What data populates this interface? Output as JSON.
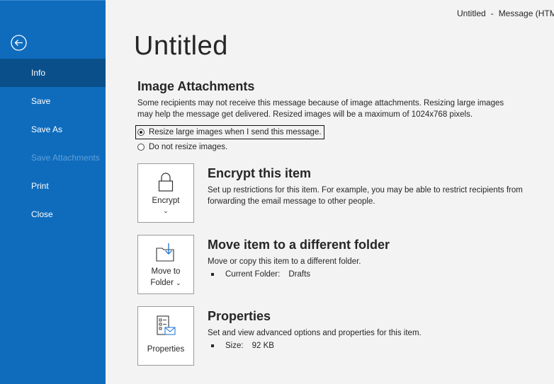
{
  "window": {
    "title": "Untitled",
    "separator": "-",
    "app_title": "Message (HTM"
  },
  "nav": {
    "items": [
      {
        "label": "Info",
        "active": true
      },
      {
        "label": "Save"
      },
      {
        "label": "Save As"
      },
      {
        "label": "Save Attachments",
        "disabled": true
      },
      {
        "label": "Print"
      },
      {
        "label": "Close"
      }
    ]
  },
  "page": {
    "title": "Untitled"
  },
  "image_attachments": {
    "heading": "Image Attachments",
    "description": "Some recipients may not receive this message because of image attachments. Resizing large images may help the message get delivered. Resized images will be a maximum of 1024x768 pixels.",
    "options": [
      {
        "label": "Resize large images when I send this message.",
        "selected": true
      },
      {
        "label": "Do not resize images.",
        "selected": false
      }
    ]
  },
  "encrypt": {
    "tile_label": "Encrypt",
    "chevron": "⌄",
    "heading": "Encrypt this item",
    "description": "Set up restrictions for this item. For example, you may be able to restrict recipients from forwarding the email message to other people."
  },
  "move": {
    "tile_label_line1": "Move to",
    "tile_label_line2": "Folder",
    "chevron": "⌄",
    "heading": "Move item to a different folder",
    "description": "Move or copy this item to a different folder.",
    "folder_label": "Current Folder:",
    "folder_value": "Drafts"
  },
  "properties": {
    "tile_label": "Properties",
    "heading": "Properties",
    "description": "Set and view advanced options and properties for this item.",
    "size_label": "Size:",
    "size_value": "92 KB"
  },
  "colors": {
    "nav_bg": "#0f6cbd",
    "nav_active": "#0a4f8a",
    "content_bg": "#f3f3f3"
  }
}
